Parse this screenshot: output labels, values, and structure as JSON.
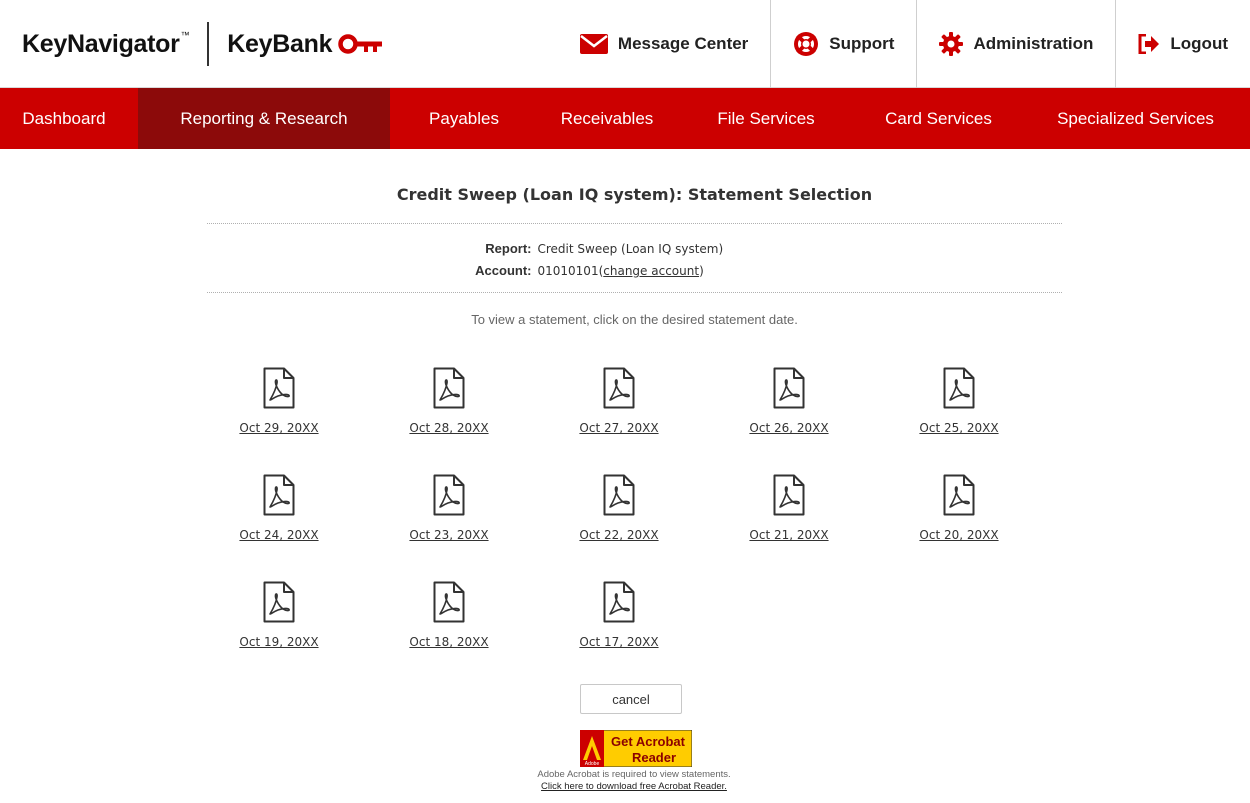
{
  "brand": {
    "app_name": "KeyNavigator",
    "app_mark": "™",
    "bank_name": "KeyBank",
    "brand_color": "#cc0000"
  },
  "utility_nav": [
    {
      "label": "Message Center",
      "icon": "envelope-icon"
    },
    {
      "label": "Support",
      "icon": "lifebuoy-icon"
    },
    {
      "label": "Administration",
      "icon": "gear-icon"
    },
    {
      "label": "Logout",
      "icon": "logout-arrow-icon"
    }
  ],
  "main_nav": {
    "active": "Reporting & Research",
    "items": [
      "Dashboard",
      "Reporting & Research",
      "Payables",
      "Receivables",
      "File Services",
      "Card Services",
      "Specialized Services"
    ]
  },
  "page": {
    "title": "Credit Sweep (Loan IQ system): Statement Selection",
    "report_label": "Report:",
    "report_value": "Credit Sweep (Loan IQ system)",
    "account_label": "Account:",
    "account_value": "01010101",
    "change_account_link": "change account",
    "instructions": "To view a statement, click on the desired statement date."
  },
  "statements": [
    "Oct 29, 20XX",
    "Oct 28, 20XX",
    "Oct 27, 20XX",
    "Oct 26, 20XX",
    "Oct 25, 20XX",
    "Oct 24, 20XX",
    "Oct 23, 20XX",
    "Oct 22, 20XX",
    "Oct 21, 20XX",
    "Oct 20, 20XX",
    "Oct 19, 20XX",
    "Oct 18, 20XX",
    "Oct 17, 20XX"
  ],
  "actions": {
    "cancel_label": "cancel"
  },
  "acrobat": {
    "badge_line1": "Get Acrobat",
    "badge_line2": "Reader",
    "badge_brand": "Adobe",
    "note": "Adobe Acrobat is required to view statements.",
    "download_link": "Click here to download free Acrobat Reader."
  }
}
